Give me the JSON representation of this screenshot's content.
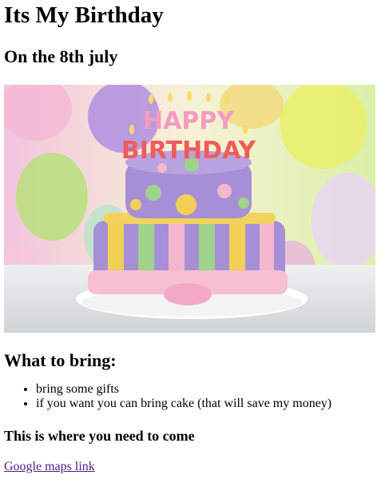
{
  "page": {
    "title": "Its My Birthday",
    "subtitle": "On the 8th july",
    "image": {
      "banner_text_line1": "HAPPY",
      "banner_text_line2": "BIRTHDAY"
    },
    "bring_heading": "What to bring:",
    "bring_items": [
      "bring some gifts",
      "if you want you can bring cake (that will save my money)"
    ],
    "where_heading": "This is where you need to come",
    "maps_link_label": "Google maps link"
  },
  "colors": {
    "link_visited": "#551a8b",
    "cake_purple": "#a78fd6",
    "cake_green": "#9fd28a",
    "cake_yellow": "#f2cf55",
    "cake_pink": "#f5b7cd"
  }
}
